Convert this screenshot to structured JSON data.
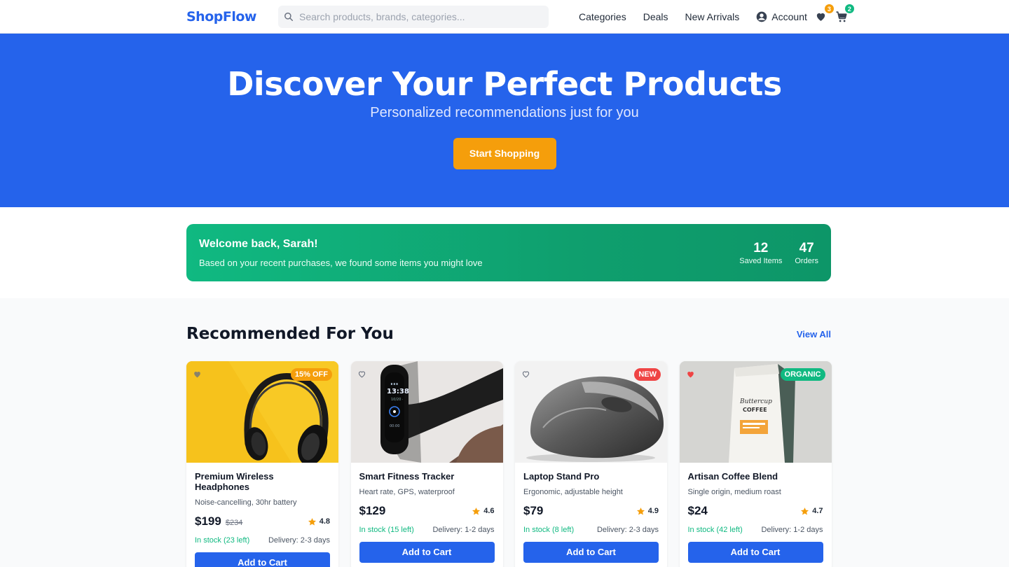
{
  "nav": {
    "logo": "ShopFlow",
    "search_placeholder": "Search products, brands, categories...",
    "links": [
      "Categories",
      "Deals",
      "New Arrivals"
    ],
    "account_label": "Account",
    "wishlist_count": "3",
    "cart_count": "2"
  },
  "hero": {
    "title": "Discover Your Perfect Products",
    "subtitle": "Personalized recommendations just for you",
    "cta": "Start Shopping"
  },
  "welcome": {
    "greeting": "Welcome back, Sarah!",
    "message": "Based on your recent purchases, we found some items you might love",
    "stats": [
      {
        "value": "12",
        "label": "Saved Items"
      },
      {
        "value": "47",
        "label": "Orders"
      }
    ]
  },
  "recommended": {
    "title": "Recommended For You",
    "view_all": "View All",
    "add_label": "Add to Cart",
    "products": [
      {
        "name": "Premium Wireless Headphones",
        "desc": "Noise-cancelling, 30hr battery",
        "price": "$199",
        "old_price": "$234",
        "rating": "4.8",
        "stock": "In stock (23 left)",
        "delivery": "Delivery: 2-3 days",
        "tag": "15% OFF",
        "tag_color": "#f59e0b",
        "favorited": false
      },
      {
        "name": "Smart Fitness Tracker",
        "desc": "Heart rate, GPS, waterproof",
        "price": "$129",
        "old_price": "",
        "rating": "4.6",
        "stock": "In stock (15 left)",
        "delivery": "Delivery: 1-2 days",
        "tag": "",
        "tag_color": "",
        "favorited": false
      },
      {
        "name": "Laptop Stand Pro",
        "desc": "Ergonomic, adjustable height",
        "price": "$79",
        "old_price": "",
        "rating": "4.9",
        "stock": "In stock (8 left)",
        "delivery": "Delivery: 2-3 days",
        "tag": "NEW",
        "tag_color": "#ef4444",
        "favorited": false
      },
      {
        "name": "Artisan Coffee Blend",
        "desc": "Single origin, medium roast",
        "price": "$24",
        "old_price": "",
        "rating": "4.7",
        "stock": "In stock (42 left)",
        "delivery": "Delivery: 1-2 days",
        "tag": "ORGANIC",
        "tag_color": "#10b981",
        "favorited": true
      }
    ]
  },
  "colors": {
    "brand": "#2563eb",
    "accent": "#f59e0b",
    "success": "#10b981",
    "danger": "#ef4444"
  }
}
